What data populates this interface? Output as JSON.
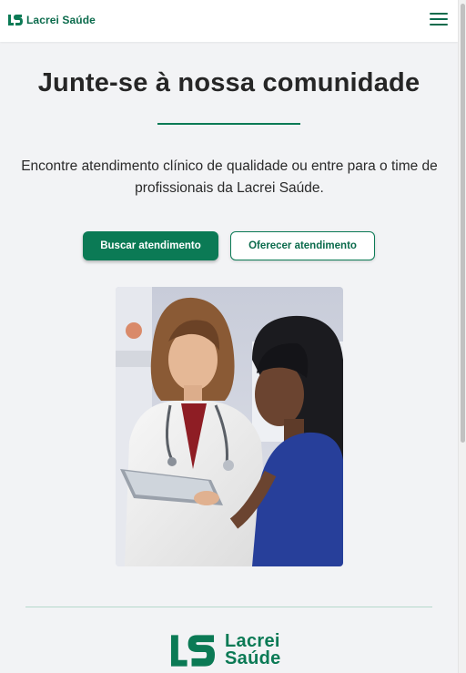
{
  "header": {
    "brand": "Lacrei Saúde",
    "menu_icon": "hamburger-menu-icon",
    "logo_icon": "lacrei-logo-icon"
  },
  "hero": {
    "title": "Junte-se à nossa comunidade",
    "description": "Encontre atendimento clínico de qualidade ou entre para o time de profissionais da Lacrei Saúde.",
    "primary_button": "Buscar atendimento",
    "secondary_button": "Oferecer atendimento"
  },
  "footer": {
    "logo_word_1": "Lacrei",
    "logo_word_2": "Saúde"
  },
  "colors": {
    "brand_green": "#0b7a55",
    "brand_green_dark": "#0b6b4c",
    "background": "#f2f3f5"
  }
}
